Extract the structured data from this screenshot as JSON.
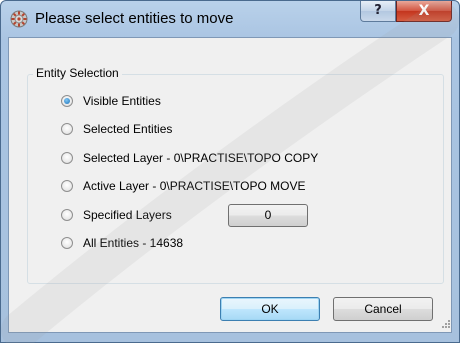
{
  "dialog": {
    "title": "Please select entities to move",
    "help_label": "?",
    "close_label": "X",
    "icon": "app-gear-icon"
  },
  "entity_selection": {
    "legend": "Entity Selection",
    "options": [
      {
        "label": "Visible Entities",
        "checked": true
      },
      {
        "label": "Selected Entities",
        "checked": false
      },
      {
        "label": "Selected Layer - 0\\PRACTISE\\TOPO COPY",
        "checked": false
      },
      {
        "label": "Active Layer - 0\\PRACTISE\\TOPO MOVE",
        "checked": false
      },
      {
        "label": "Specified Layers",
        "checked": false
      },
      {
        "label": "All Entities - 14638",
        "checked": false
      }
    ],
    "specified_layers_button": "0"
  },
  "buttons": {
    "ok": "OK",
    "cancel": "Cancel"
  },
  "colors": {
    "title_bar": "#b9d1ea",
    "close_button": "#c3351e",
    "radio_selected": "#1d72b8"
  }
}
